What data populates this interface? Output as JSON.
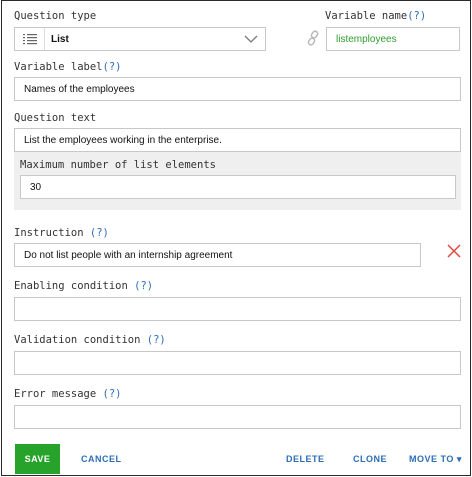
{
  "question_type": {
    "label": "Question type",
    "selected": "List",
    "icon": "list-lines-icon"
  },
  "variable_name": {
    "label": "Variable name",
    "help": "(?)",
    "value": "listemployees",
    "link_icon": "link-icon"
  },
  "variable_label": {
    "label": "Variable label",
    "help": "(?)",
    "value": "Names of the employees"
  },
  "question_text": {
    "label": "Question text",
    "value": "List the employees working in the enterprise."
  },
  "max_list": {
    "label": "Maximum number of list elements",
    "value": "30"
  },
  "instruction": {
    "label": "Instruction",
    "help": "(?)",
    "value": "Do not list people with an internship agreement",
    "remove_icon": "close-x-icon"
  },
  "enabling_condition": {
    "label": "Enabling condition",
    "help": "(?)",
    "value": ""
  },
  "validation_condition": {
    "label": "Validation condition",
    "help": "(?)",
    "value": ""
  },
  "error_message": {
    "label": "Error message",
    "help": "(?)",
    "value": ""
  },
  "actions": {
    "save": "SAVE",
    "cancel": "CANCEL",
    "delete": "DELETE",
    "clone": "CLONE",
    "move_to": "MOVE TO",
    "move_to_arrow": "▾"
  },
  "colors": {
    "save_bg": "#27a22a",
    "link": "#2d6db5",
    "variable_name_text": "#2e9e2e",
    "remove_icon": "#e0433a"
  }
}
